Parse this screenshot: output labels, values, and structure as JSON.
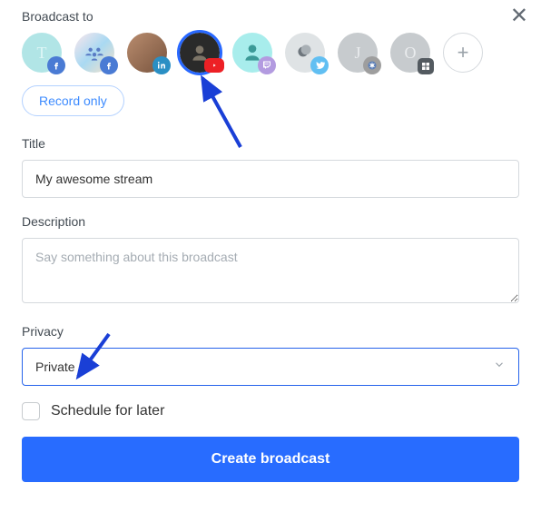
{
  "header": {
    "label": "Broadcast to"
  },
  "destinations": [
    {
      "name": "dest-t-facebook",
      "letter": "T",
      "platform": "facebook",
      "selected": false
    },
    {
      "name": "dest-group-facebook",
      "letter": "",
      "platform": "facebook",
      "selected": false
    },
    {
      "name": "dest-user-linkedin",
      "letter": "",
      "platform": "linkedin",
      "selected": false
    },
    {
      "name": "dest-user-youtube",
      "letter": "",
      "platform": "youtube",
      "selected": true
    },
    {
      "name": "dest-user-twitch",
      "letter": "",
      "platform": "twitch",
      "selected": false
    },
    {
      "name": "dest-user-twitter",
      "letter": "",
      "platform": "twitter",
      "selected": false
    },
    {
      "name": "dest-j-custom",
      "letter": "J",
      "platform": "custom-spiral",
      "selected": false
    },
    {
      "name": "dest-o-grid",
      "letter": "O",
      "platform": "grid",
      "selected": false
    }
  ],
  "record_only_label": "Record only",
  "title": {
    "label": "Title",
    "value": "My awesome stream"
  },
  "description": {
    "label": "Description",
    "placeholder": "Say something about this broadcast",
    "value": ""
  },
  "privacy": {
    "label": "Privacy",
    "value": "Private"
  },
  "schedule": {
    "label": "Schedule for later",
    "checked": false
  },
  "create_button_label": "Create broadcast"
}
